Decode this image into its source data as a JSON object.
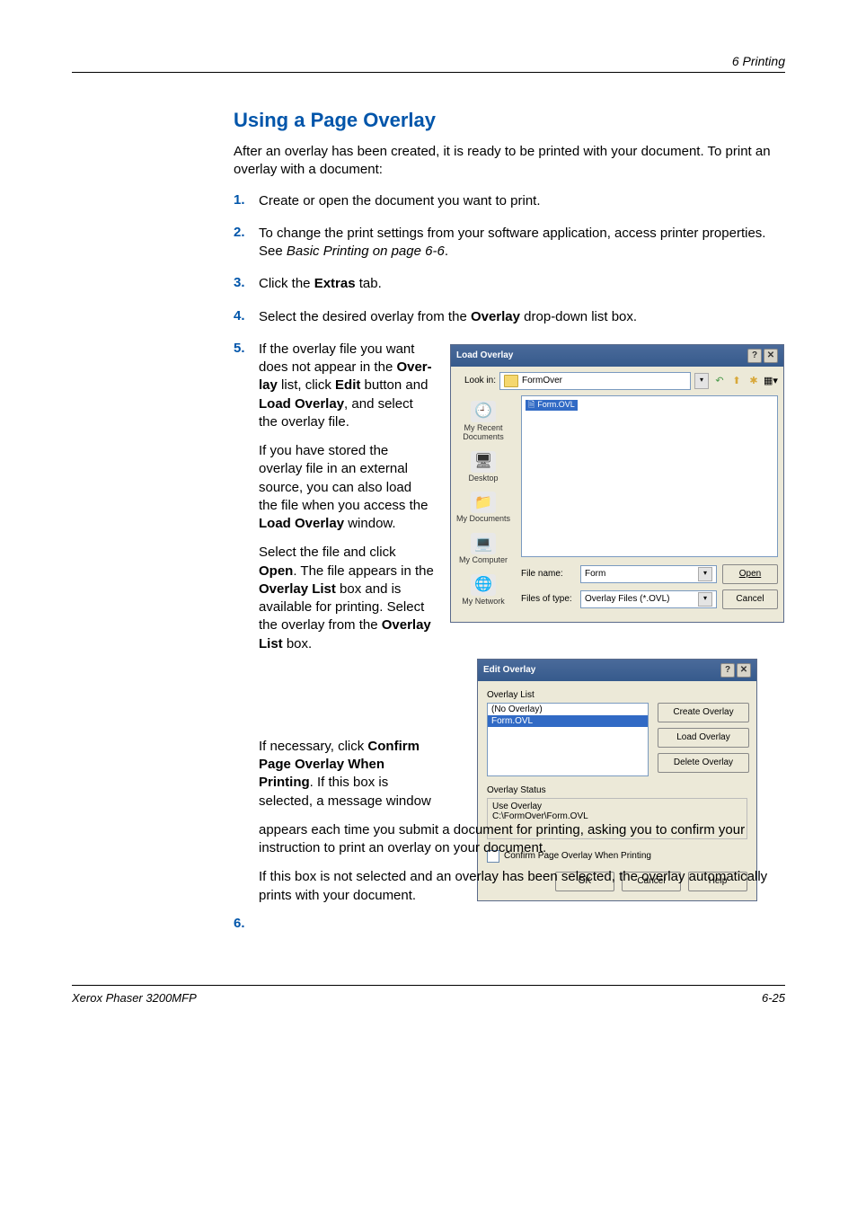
{
  "header": {
    "section": "6   Printing"
  },
  "title": "Using a Page Overlay",
  "intro": "After an overlay has been created, it is ready to be printed with your document. To print an overlay with a document:",
  "steps": {
    "s1": {
      "num": "1.",
      "text": "Create or open the document you want to print."
    },
    "s2": {
      "num": "2.",
      "pre": "To change the print settings from your software application, access printer properties. See ",
      "em": "Basic Printing on page 6-6",
      "post": "."
    },
    "s3": {
      "num": "3.",
      "pre": "Click the ",
      "b": "Extras",
      "post": " tab."
    },
    "s4": {
      "num": "4.",
      "pre": "Select the desired overlay from the ",
      "b": "Overlay",
      "post": " drop-down list box."
    },
    "s5": {
      "num": "5.",
      "p1": {
        "a": "If the overlay file you want does not appear in the ",
        "b1": "Over­lay",
        "c": " list, click ",
        "b2": "Edit",
        "d": " but­ton and ",
        "b3": "Load Overlay",
        "e": ", and select the overlay file."
      },
      "p2": {
        "a": "If you have stored the overlay file in an external source, you can also load the file when you access the ",
        "b": "Load Overlay",
        "c": " window."
      },
      "p3": {
        "a": "Select the file and click ",
        "b1": "Open",
        "c": ". The file appears in the ",
        "b2": "Overlay List",
        "d": " box and is available for printing. Select the overlay from the ",
        "b3": "Overlay List",
        "e": " box."
      }
    },
    "s6": {
      "num": "6.",
      "p1": {
        "a": "If necessary, click ",
        "b": "Confirm Page Over­lay When Printing",
        "c": ". If this box is selected, a message window appears each time you submit a document for printing, asking you to confirm your instruction to print an overlay on your document."
      },
      "p2": "If this box is not selected and an overlay has been selected, the overlay automatically prints with your document."
    }
  },
  "load": {
    "title": "Load Overlay",
    "lookin_lbl": "Look in:",
    "lookin_val": "FormOver",
    "file": "Form.OVL",
    "places": {
      "recent": "My Recent Documents",
      "desktop": "Desktop",
      "docs": "My Documents",
      "comp": "My Computer",
      "net": "My Network"
    },
    "filename_lbl": "File name:",
    "filename_val": "Form",
    "filetype_lbl": "Files of type:",
    "filetype_val": "Overlay Files (*.OVL)",
    "open_btn": "Open",
    "cancel_btn": "Cancel"
  },
  "edit": {
    "title": "Edit Overlay",
    "list_lbl": "Overlay List",
    "item0": "(No Overlay)",
    "item1": "Form.OVL",
    "create_btn": "Create Overlay",
    "load_btn": "Load Overlay",
    "delete_btn": "Delete Overlay",
    "status_lbl": "Overlay Status",
    "status_l1": "Use Overlay",
    "status_l2": "C:\\FormOver\\Form.OVL",
    "confirm": "Confirm Page Overlay When Printing",
    "ok": "OK",
    "cancel": "Cancel",
    "help": "Help"
  },
  "footer": {
    "left": "Xerox Phaser 3200MFP",
    "right": "6-25"
  }
}
